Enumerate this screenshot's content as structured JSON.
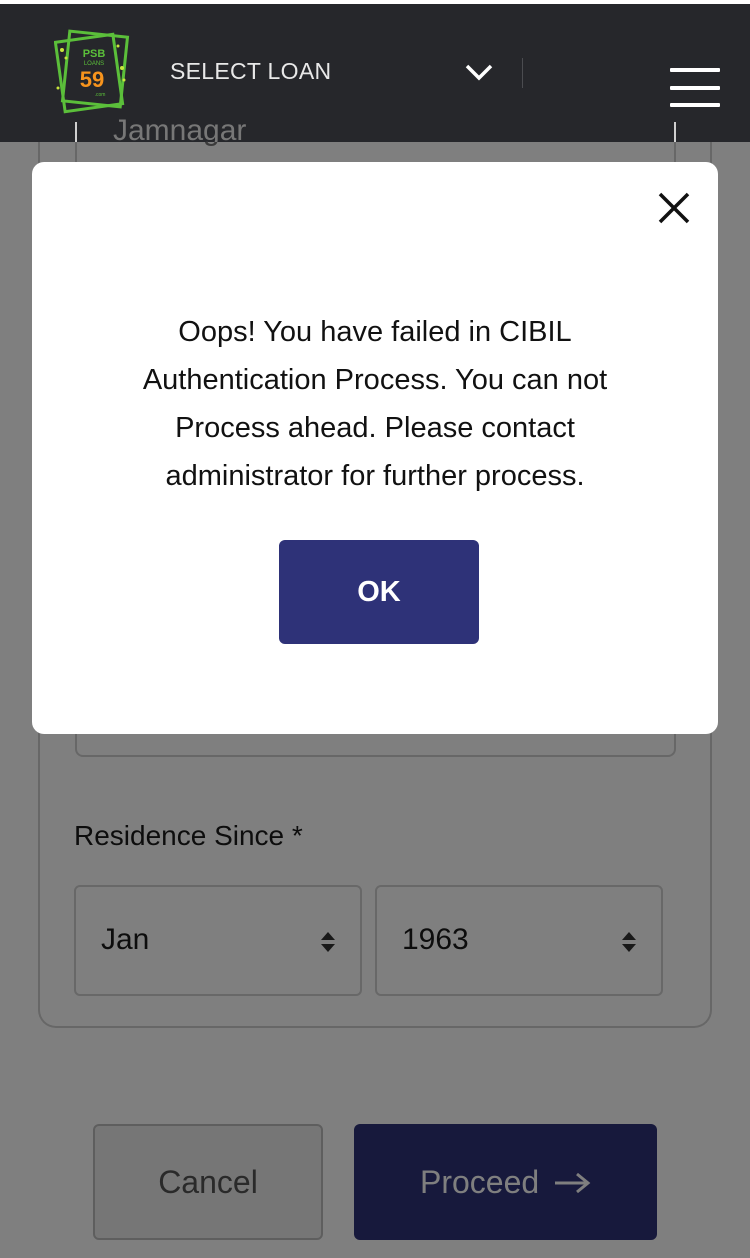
{
  "header": {
    "logo": {
      "line1": "PSB",
      "line2": "LOANS",
      "line3": "59",
      "line4": ".com"
    },
    "select_loan_label": "SELECT LOAN"
  },
  "form": {
    "previous_field_value": "Jamnagar",
    "residence_since_label": "Residence Since *",
    "month_value": "Jan",
    "year_value": "1963",
    "cancel_label": "Cancel",
    "proceed_label": "Proceed"
  },
  "modal": {
    "message": "Oops! You have failed in CIBIL Authentication Process. You can not Process ahead. Please contact administrator for further process.",
    "ok_label": "OK"
  },
  "colors": {
    "header_bg": "#26272b",
    "primary_button": "#2e3278",
    "logo_green": "#5bbf3a",
    "logo_orange": "#f7941d"
  },
  "icons": [
    "logo-icon",
    "chevron-down-icon",
    "hamburger-menu-icon",
    "select-arrows-icon",
    "arrow-right-icon",
    "close-icon"
  ]
}
